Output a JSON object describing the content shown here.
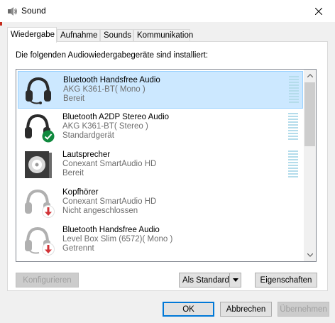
{
  "window": {
    "title": "Sound"
  },
  "tabs": [
    {
      "label": "Wiedergabe"
    },
    {
      "label": "Aufnahme"
    },
    {
      "label": "Sounds"
    },
    {
      "label": "Kommunikation"
    }
  ],
  "panel": {
    "label": "Die folgenden Audiowiedergabegeräte sind installiert:"
  },
  "devices": [
    {
      "name": "Bluetooth Handsfree Audio",
      "sub": "AKG K361-BT( Mono )",
      "status": "Bereit",
      "icon": "headset-icon",
      "badge": ""
    },
    {
      "name": "Bluetooth A2DP Stereo Audio",
      "sub": "AKG K361-BT( Stereo )",
      "status": "Standardgerät",
      "icon": "headphones-icon",
      "badge": "default-check-badge"
    },
    {
      "name": "Lautsprecher",
      "sub": "Conexant SmartAudio HD",
      "status": "Bereit",
      "icon": "speaker-icon",
      "badge": ""
    },
    {
      "name": "Kopfhörer",
      "sub": "Conexant SmartAudio HD",
      "status": "Nicht angeschlossen",
      "icon": "headphones-icon",
      "badge": "disconnected-arrow-badge"
    },
    {
      "name": "Bluetooth Handsfree Audio",
      "sub": "Level Box Slim (6572)( Mono )",
      "status": "Getrennt",
      "icon": "headset-icon",
      "badge": "disconnected-arrow-badge"
    }
  ],
  "buttons": {
    "configure": "Konfigurieren",
    "set_default": "Als Standard",
    "properties": "Eigenschaften",
    "ok": "OK",
    "cancel": "Abbrechen",
    "apply": "Übernehmen"
  },
  "colors": {
    "selection": "#cce8ff",
    "selection_border": "#99d1ff",
    "check_green": "#10893e",
    "arrow_red": "#d13438",
    "meter": "#b4dceb"
  }
}
